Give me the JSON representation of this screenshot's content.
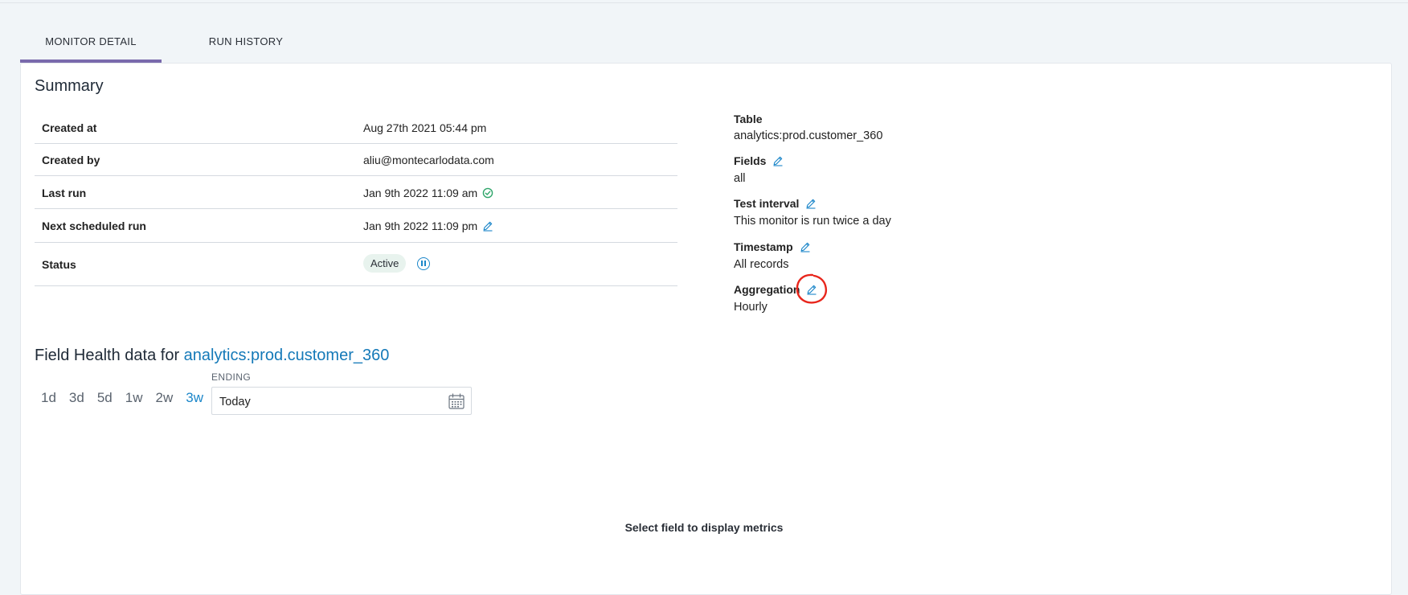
{
  "tabs": [
    {
      "label": "MONITOR DETAIL",
      "active": true
    },
    {
      "label": "RUN HISTORY",
      "active": false
    }
  ],
  "summary": {
    "title": "Summary",
    "rows": [
      {
        "label": "Created at",
        "value": "Aug 27th 2021 05:44 pm"
      },
      {
        "label": "Created by",
        "value": "aliu@montecarlodata.com"
      },
      {
        "label": "Last run",
        "value": "Jan 9th 2022 11:09 am",
        "icon": "check-circle-icon"
      },
      {
        "label": "Next scheduled run",
        "value": "Jan 9th 2022 11:09 pm",
        "icon": "edit-icon"
      },
      {
        "label": "Status",
        "badge": "Active",
        "icon": "pause-icon"
      }
    ]
  },
  "details": {
    "table_label": "Table",
    "table_value": "analytics:prod.customer_360",
    "fields_label": "Fields",
    "fields_value": "all",
    "interval_label": "Test interval",
    "interval_value": "This monitor is run twice a day",
    "timestamp_label": "Timestamp",
    "timestamp_value": "All records",
    "aggregation_label": "Aggregation",
    "aggregation_value": "Hourly"
  },
  "field_health": {
    "title_prefix": "Field Health data for",
    "table_link": "analytics:prod.customer_360",
    "ranges": [
      "1d",
      "3d",
      "5d",
      "1w",
      "2w",
      "3w"
    ],
    "active_range": "3w",
    "ending_label": "ENDING",
    "ending_value": "Today",
    "empty_message": "Select field to display metrics"
  },
  "colors": {
    "accent": "#1b86c9",
    "tab_indicator": "#7a6aac",
    "annotation": "#e8261c",
    "success": "#2fa56a"
  }
}
